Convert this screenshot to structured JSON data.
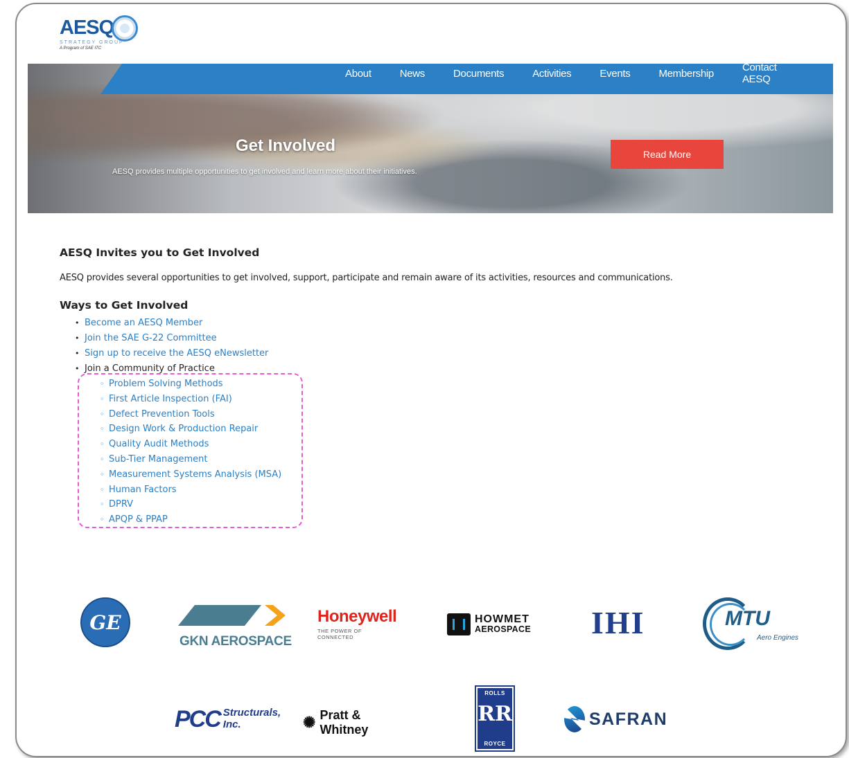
{
  "logo": {
    "wordmark": "AESQ",
    "subtitle": "STRATEGY GROUP",
    "program": "A Program of SAE ITC"
  },
  "nav": {
    "items": [
      "About",
      "News",
      "Documents",
      "Activities",
      "Events",
      "Membership",
      "Contact AESQ"
    ]
  },
  "hero": {
    "title": "Get Involved",
    "subtitle": "AESQ provides multiple opportunities to get involved and learn more about their initiatives.",
    "button": "Read More"
  },
  "content": {
    "heading": "AESQ Invites you to Get Involved",
    "intro": "AESQ provides several opportunities to get involved, support, participate and remain aware of its activities, resources and communications.",
    "ways_heading": "Ways to Get Involved",
    "ways": [
      "Become an AESQ Member",
      "Join the SAE G-22 Committee",
      "Sign up to receive the AESQ eNewsletter",
      "Join a Community of Practice"
    ],
    "communities": [
      "Problem Solving Methods",
      "First Article Inspection (FAI)",
      "Defect Prevention Tools",
      "Design Work & Production Repair",
      "Quality Audit Methods",
      "Sub-Tier Management",
      "Measurement Systems Analysis (MSA)",
      "Human Factors",
      "DPRV",
      "APQP & PPAP"
    ]
  },
  "sponsors": {
    "ge": "GE",
    "gkn": "GKN AEROSPACE",
    "honeywell": "Honeywell",
    "honeywell_tag": "THE POWER OF CONNECTED",
    "howmet_1": "HOWMET",
    "howmet_2": "AEROSPACE",
    "ihi": "IHI",
    "mtu": "MTU",
    "mtu_sub": "Aero Engines",
    "pcc": "PCC",
    "pcc_sub": "Structurals, Inc.",
    "pw": "Pratt & Whitney",
    "rr_top": "ROLLS",
    "rr_mid": "RR",
    "rr_bot": "ROYCE",
    "safran": "SAFRAN"
  },
  "colors": {
    "nav_bg": "#2b80c6",
    "link": "#2b7fc4",
    "button": "#e8453c",
    "highlight": "#e85ad2"
  }
}
